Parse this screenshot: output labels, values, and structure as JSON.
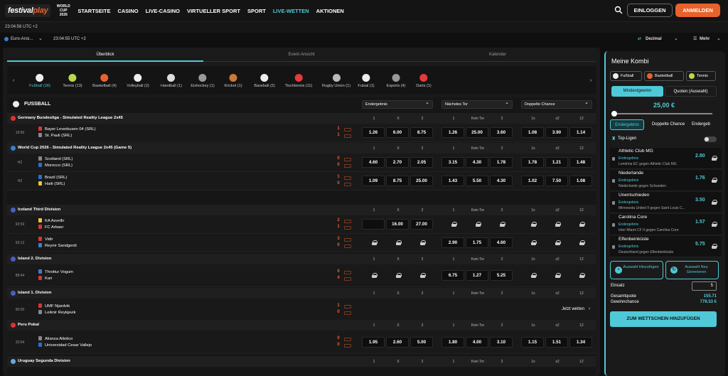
{
  "brand": {
    "logo_a": "festival",
    "logo_b": "play",
    "wc": "WORLD CUP 2026"
  },
  "nav": [
    "STARTSEITE",
    "CASINO",
    "LIVE-CASINO",
    "VIRTUELLER SPORT",
    "SPORT",
    "LIVE-WETTEN",
    "AKTIONEN"
  ],
  "auth": {
    "login": "EINLOGGEN",
    "register": "ANMELDEN"
  },
  "clock": "23:04:56 UTC +2",
  "options": {
    "odds_region": "Euro-Ansi...",
    "clock2": "23:04:55 UTC +2",
    "format": "Dezimal",
    "more": "Mehr"
  },
  "tabs": [
    "Überblick",
    "Event-Ansicht",
    "Kalender"
  ],
  "sports": [
    {
      "label": "Fußball (28)",
      "color": "#eeeeee"
    },
    {
      "label": "Tennis (13)",
      "color": "#b9d84a"
    },
    {
      "label": "Basketball (4)",
      "color": "#e8622c"
    },
    {
      "label": "Volleyball (2)",
      "color": "#eeeeee"
    },
    {
      "label": "Handball (1)",
      "color": "#dddddd"
    },
    {
      "label": "Eishockey (1)",
      "color": "#999999"
    },
    {
      "label": "Kricket (1)",
      "color": "#c87a3a"
    },
    {
      "label": "Baseball (2)",
      "color": "#eeeeee"
    },
    {
      "label": "Tischtennis (11)",
      "color": "#e23b3b"
    },
    {
      "label": "Rugby Union (1)",
      "color": "#bbbbbb"
    },
    {
      "label": "Futsal (1)",
      "color": "#eeeeee"
    },
    {
      "label": "Esports (4)",
      "color": "#999999"
    },
    {
      "label": "Darts (1)",
      "color": "#e23b3b"
    }
  ],
  "football": {
    "title": "FUSSBALL",
    "sel1": "Endergebnis",
    "sel2": "Nächstes Tor",
    "sel3": "Doppelte Chance"
  },
  "colheads": [
    "1",
    "X",
    "2",
    "1",
    "Kein Tor",
    "2",
    "1x",
    "x2",
    "12"
  ],
  "leagues": [
    {
      "name": "Germany Bundesliga - Simulated Reality League 2x45",
      "flag": "#d33"
    },
    {
      "name": "World Cup 2026 - Simulated Reality League 2x45 (Game 5)",
      "flag": "#3a7fd0"
    },
    {
      "name": "Iceland Third Division",
      "flag": "#4a5fc0"
    },
    {
      "name": "Island 2. Division",
      "flag": "#4a5fc0"
    },
    {
      "name": "Island 1. Division",
      "flag": "#4a5fc0"
    },
    {
      "name": "Peru Pokal",
      "flag": "#d33"
    },
    {
      "name": "Uruguay Segunda Division",
      "flag": "#6aa8e0"
    }
  ],
  "matches": [
    {
      "time": "19:56",
      "home": "Bayer Leverkusen 04 (SRL)",
      "away": "St. Pauli (SRL)",
      "sh": "1",
      "sa": "1",
      "odds": [
        "1.26",
        "6.00",
        "8.75",
        "1.26",
        "25.00",
        "3.60",
        "1.08",
        "3.90",
        "1.14"
      ]
    },
    {
      "time": "HZ",
      "home": "Scotland (SRL)",
      "away": "Morocco (SRL)",
      "sh": "0",
      "sa": "0",
      "odds": [
        "4.60",
        "2.70",
        "2.05",
        "3.15",
        "4.30",
        "1.78",
        "1.78",
        "1.21",
        "1.48"
      ]
    },
    {
      "time": "HZ",
      "home": "Brazil (SRL)",
      "away": "Haiti (SRL)",
      "sh": "1",
      "sa": "0",
      "odds": [
        "1.09",
        "8.75",
        "25.00",
        "1.43",
        "5.50",
        "4.30",
        "1.02",
        "7.50",
        "1.08"
      ]
    },
    {
      "time": "92:59",
      "home": "KA Asvellir",
      "away": "FC Arbaer",
      "sh": "2",
      "sa": "1",
      "odds": [
        "",
        "16.00",
        "27.00",
        "L",
        "L",
        "L",
        "L",
        "L",
        "L"
      ]
    },
    {
      "time": "93:12",
      "home": "Vidir",
      "away": "Reynir Sandgerdi",
      "sh": "3",
      "sa": "0",
      "odds": [
        "L",
        "L",
        "L",
        "2.90",
        "1.75",
        "4.60",
        "L",
        "L",
        "L"
      ]
    },
    {
      "time": "88:44",
      "home": "Throttur Vogum",
      "away": "Kari",
      "sh": "0",
      "sa": "4",
      "odds": [
        "L",
        "L",
        "L",
        "6.75",
        "1.27",
        "5.25",
        "L",
        "L",
        "L"
      ]
    },
    {
      "time": "90:00",
      "home": "UMF Njardvik",
      "away": "Leiknir Reykjavik",
      "sh": "1",
      "sa": "0",
      "odds": [],
      "bet_now": "Jetzt wetten"
    },
    {
      "time": "32:04",
      "home": "Alianza Atletico",
      "away": "Universidad Cesar Vallejo",
      "sh": "0",
      "sa": "0",
      "odds": [
        "1.95",
        "2.60",
        "5.00",
        "1.80",
        "4.00",
        "3.10",
        "1.15",
        "1.51",
        "1.34"
      ]
    }
  ],
  "kombi": {
    "title": "Meine Kombi",
    "chips": [
      "Fußball",
      "Basketball",
      "Tennis"
    ],
    "toggle": [
      "Mindestgewinn",
      "Quoten (Auswahl)"
    ],
    "amount": "25,00 €",
    "market_tabs": [
      "Endergebnis",
      "Doppelte Chance",
      "Endergeb"
    ],
    "top_leagues": "Top-Ligen",
    "picks": [
      {
        "name": "Athletic Club MG",
        "market": "Endergebnis",
        "event": "Londrina EC gegen Athletic Club MG",
        "odd": "2.80"
      },
      {
        "name": "Niederlande",
        "market": "Endergebnis",
        "event": "Niederlande gegen Schweden",
        "odd": "1.76"
      },
      {
        "name": "Unentschieden",
        "market": "Endergebnis",
        "event": "Minnesota United II gegen Saint Louis C...",
        "odd": "3.50"
      },
      {
        "name": "Carolina Core",
        "market": "Endergebnis",
        "event": "Inter Miami CF II gegen Carolina Core",
        "odd": "1.57"
      },
      {
        "name": "Elfenbeinküste",
        "market": "Endergebnis",
        "event": "Deutschland gegen Elfenbeinküste",
        "odd": "5.75"
      }
    ],
    "add_btn": "Auswahl Hinzufügen",
    "gen_btn": "Auswahl Neu Generieren",
    "stake_label": "Einsatz",
    "stake": "5",
    "total_label": "Gesamtquote",
    "total": "155.71",
    "win_label": "Gewinnchance",
    "win": "778.53 €",
    "submit": "ZUM WETTSCHEIN HINZUFÜGEN"
  },
  "colors": {
    "accent": "#4fc9d8",
    "orange": "#e8622c"
  }
}
